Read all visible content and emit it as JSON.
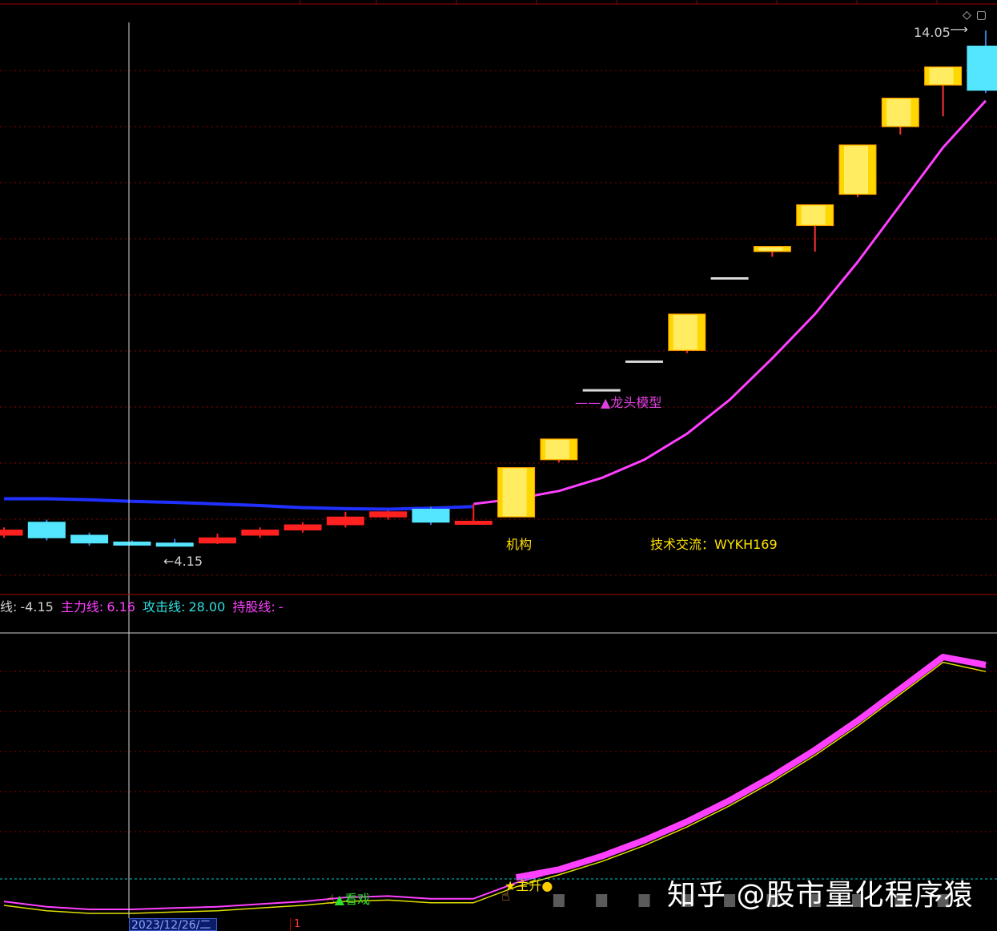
{
  "colors": {
    "background": "#000000",
    "grid": "#8b0000",
    "up_candle_gold": "#ffd700",
    "down_candle_cyan": "#55e6ff",
    "down_candle_red": "#ff2020",
    "main_line": "#ff40ff",
    "blue_line": "#2030ff",
    "yellow_line": "#e0e000"
  },
  "price_labels": {
    "high": "14.05",
    "low": "4.15",
    "model": "龙头模型",
    "institution": "机构",
    "contact": "技术交流：WYKH169"
  },
  "infobar": {
    "item1_label": "线:",
    "item1_value": "-4.15",
    "item2_label": "主力线:",
    "item2_value": "6.16",
    "item3_label": "攻击线:",
    "item3_value": "28.00",
    "item4_label": "持股线:",
    "item4_value": "-"
  },
  "indicator_labels": {
    "watch": "看戏",
    "rise": "主升"
  },
  "footer": {
    "date": "2023/12/26/二",
    "page": "1"
  },
  "watermark": "知乎 @股市量化程序猿",
  "corner_icons": [
    "diamond-icon",
    "window-icon"
  ],
  "chart_data": {
    "type": "candlestick",
    "candles": [
      {
        "open": 4.45,
        "close": 4.35,
        "high": 4.5,
        "low": 4.3,
        "style": "red"
      },
      {
        "open": 4.6,
        "close": 4.3,
        "high": 4.65,
        "low": 4.25,
        "style": "cyan"
      },
      {
        "open": 4.35,
        "close": 4.2,
        "high": 4.4,
        "low": 4.15,
        "style": "cyan"
      },
      {
        "open": 4.22,
        "close": 4.18,
        "high": 4.25,
        "low": 4.15,
        "style": "cyan"
      },
      {
        "open": 4.2,
        "close": 4.15,
        "high": 4.28,
        "low": 4.15,
        "style": "cyan"
      },
      {
        "open": 4.2,
        "close": 4.3,
        "high": 4.38,
        "low": 4.18,
        "style": "red"
      },
      {
        "open": 4.35,
        "close": 4.45,
        "high": 4.5,
        "low": 4.3,
        "style": "red"
      },
      {
        "open": 4.45,
        "close": 4.55,
        "high": 4.6,
        "low": 4.4,
        "style": "red"
      },
      {
        "open": 4.55,
        "close": 4.7,
        "high": 4.8,
        "low": 4.5,
        "style": "red"
      },
      {
        "open": 4.7,
        "close": 4.8,
        "high": 4.82,
        "low": 4.65,
        "style": "red"
      },
      {
        "open": 4.85,
        "close": 4.6,
        "high": 4.9,
        "low": 4.55,
        "style": "cyan"
      },
      {
        "open": 4.6,
        "close": 4.62,
        "high": 4.95,
        "low": 4.58,
        "style": "red"
      },
      {
        "open": 4.7,
        "close": 5.65,
        "high": 5.65,
        "low": 4.7,
        "style": "gold"
      },
      {
        "open": 5.8,
        "close": 6.2,
        "high": 6.2,
        "low": 5.75,
        "style": "gold"
      },
      {
        "open": 7.15,
        "close": 7.15,
        "high": 7.15,
        "low": 7.15,
        "style": "doji"
      },
      {
        "open": 7.7,
        "close": 7.7,
        "high": 7.7,
        "low": 7.7,
        "style": "doji"
      },
      {
        "open": 7.9,
        "close": 8.6,
        "high": 8.6,
        "low": 7.85,
        "style": "gold"
      },
      {
        "open": 9.3,
        "close": 9.3,
        "high": 9.3,
        "low": 9.3,
        "style": "doji"
      },
      {
        "open": 9.8,
        "close": 9.9,
        "high": 9.9,
        "low": 9.7,
        "style": "gold"
      },
      {
        "open": 10.3,
        "close": 10.7,
        "high": 10.7,
        "low": 9.8,
        "style": "gold"
      },
      {
        "open": 10.9,
        "close": 11.85,
        "high": 11.85,
        "low": 10.85,
        "style": "gold"
      },
      {
        "open": 12.2,
        "close": 12.75,
        "high": 12.75,
        "low": 12.05,
        "style": "gold"
      },
      {
        "open": 13.0,
        "close": 13.35,
        "high": 13.35,
        "low": 12.4,
        "style": "gold"
      },
      {
        "open": 13.75,
        "close": 12.9,
        "high": 14.05,
        "low": 12.85,
        "style": "cyan"
      }
    ],
    "main_line": [
      null,
      null,
      null,
      null,
      null,
      null,
      null,
      null,
      null,
      null,
      null,
      4.95,
      5.05,
      5.2,
      5.45,
      5.8,
      6.3,
      6.95,
      7.75,
      8.6,
      9.6,
      10.7,
      11.8,
      12.7
    ],
    "blue_line": [
      5.05,
      5.05,
      5.03,
      5.0,
      4.98,
      4.95,
      4.92,
      4.88,
      4.86,
      4.85,
      4.87,
      4.9
    ],
    "indicator_main": [
      null,
      null,
      null,
      null,
      null,
      null,
      null,
      null,
      null,
      null,
      null,
      null,
      1.7,
      2.0,
      2.5,
      3.1,
      3.8,
      4.6,
      5.5,
      6.5,
      7.6,
      8.8,
      10.0,
      9.7
    ],
    "indicator_base": [
      0.8,
      0.6,
      0.5,
      0.5,
      0.55,
      0.6,
      0.7,
      0.8,
      0.95,
      1.0,
      0.9,
      0.9,
      1.5,
      1.95,
      2.45,
      3.05,
      3.75,
      4.55,
      5.45,
      6.45,
      7.55,
      8.75,
      9.95,
      9.6
    ],
    "indicator_bars": [
      null,
      null,
      null,
      null,
      null,
      null,
      null,
      null,
      null,
      null,
      null,
      null,
      null,
      1,
      1,
      1,
      1,
      1,
      1,
      1,
      1,
      1,
      1
    ]
  }
}
